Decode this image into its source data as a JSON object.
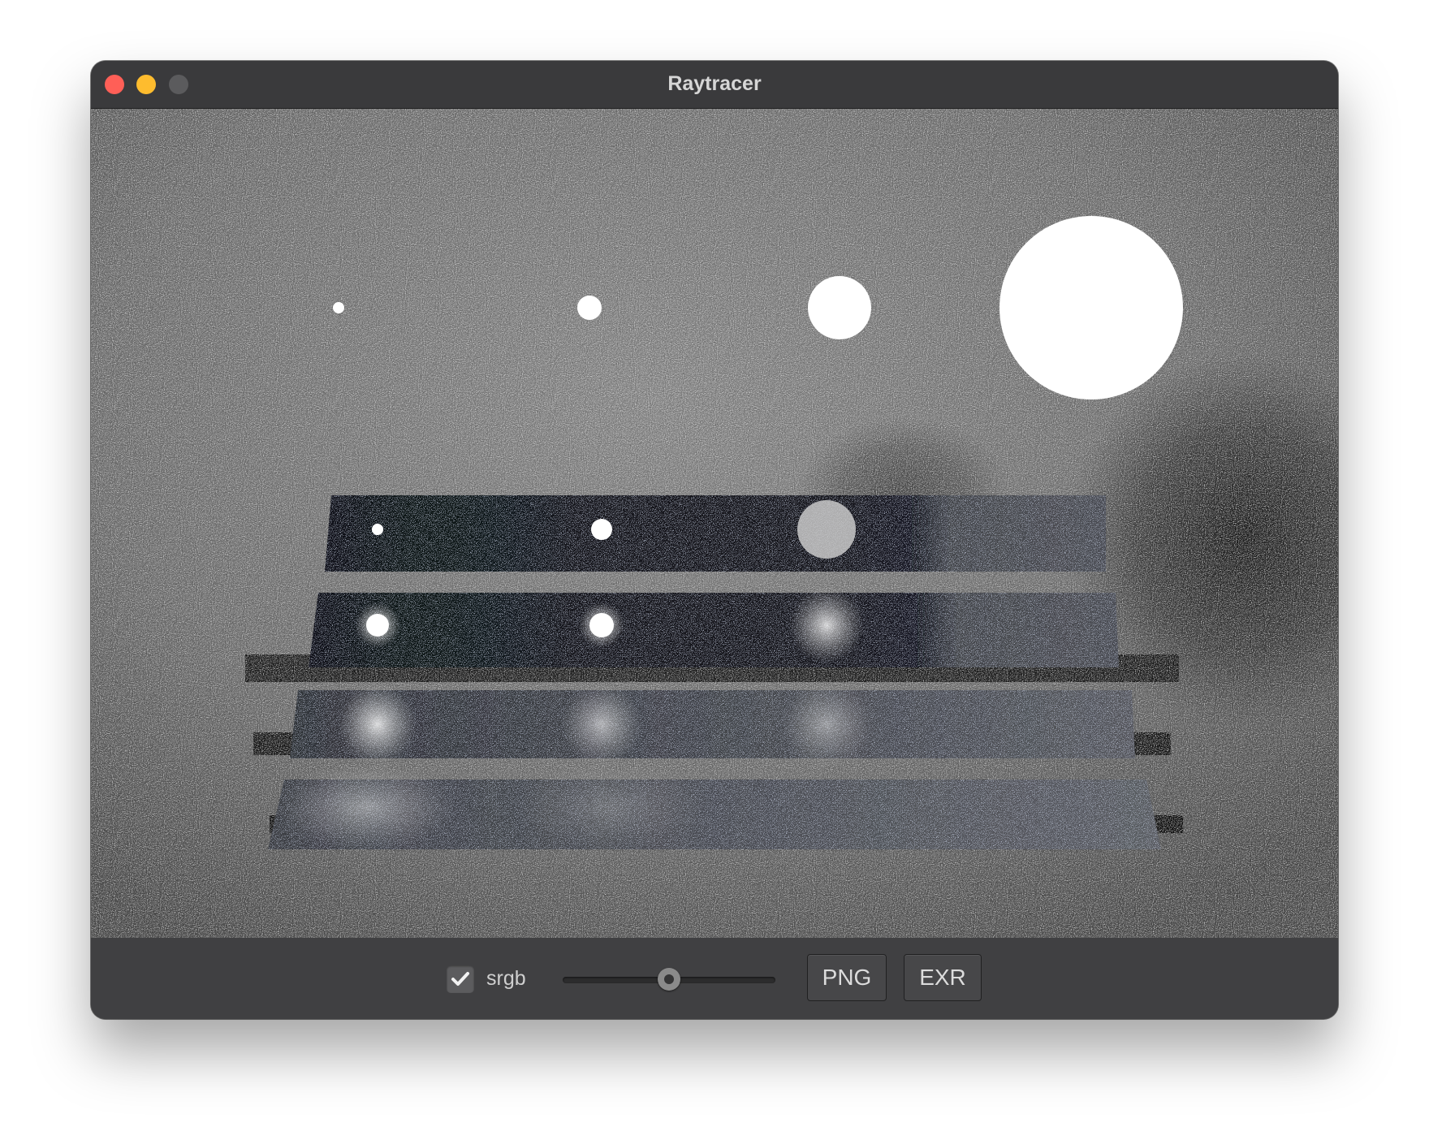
{
  "window": {
    "title": "Raytracer",
    "traffic_lights": [
      "close",
      "minimize",
      "zoom"
    ]
  },
  "viewport": {
    "content": "rendered-image"
  },
  "toolbar": {
    "srgb_checked": true,
    "srgb_label": "srgb",
    "exposure_slider_value": 0.5,
    "png_label": "PNG",
    "exr_label": "EXR"
  },
  "colors": {
    "window_bg": "#3a3a3c",
    "close": "#ff5f57",
    "minimize": "#febc2e",
    "zoom": "#5b5b5d"
  }
}
